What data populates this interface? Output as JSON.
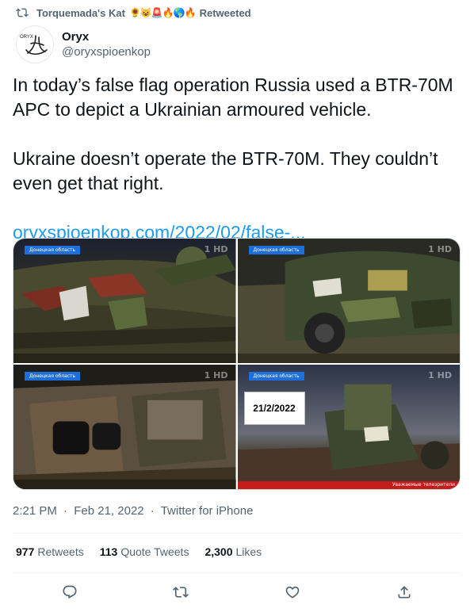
{
  "retweet": {
    "user": "Torquemada's Kat",
    "emojis": "🌻😺🚨🔥🌎🔥",
    "label": "Retweeted"
  },
  "author": {
    "display_name": "Oryx",
    "handle": "@oryxspioenkop",
    "avatar_text": "ORYX"
  },
  "tweet": {
    "paragraph1": "In today’s false flag operation Russia used a BTR-70M APC to depict a Ukrainian armoured vehicle.",
    "paragraph2": "Ukraine doesn’t operate the BTR-70M. They couldn’t even get that right.",
    "link": "oryxspioenkop.com/2022/02/false-..."
  },
  "media": {
    "frames": [
      {
        "region_tag": "Донецкая область",
        "channel": "1 HD"
      },
      {
        "region_tag": "Донецкая область",
        "channel": "1 HD"
      },
      {
        "region_tag": "Донецкая область",
        "channel": "1 HD"
      },
      {
        "region_tag": "Донецкая область",
        "channel": "1 HD"
      }
    ],
    "date_card": "21/2/2022",
    "ticker_text": "Уважаемые телезрители"
  },
  "meta": {
    "time": "2:21 PM",
    "date": "Feb 21, 2022",
    "source": "Twitter for iPhone",
    "separator": "·"
  },
  "stats": {
    "retweets_count": "977",
    "retweets_label": "Retweets",
    "quotes_count": "113",
    "quotes_label": "Quote Tweets",
    "likes_count": "2,300",
    "likes_label": "Likes"
  },
  "colors": {
    "link": "#1d9bf0",
    "secondary_text": "#536471",
    "primary_text": "#0f1419"
  },
  "icons": [
    "retweet-icon",
    "reply-icon",
    "like-icon",
    "share-icon"
  ]
}
